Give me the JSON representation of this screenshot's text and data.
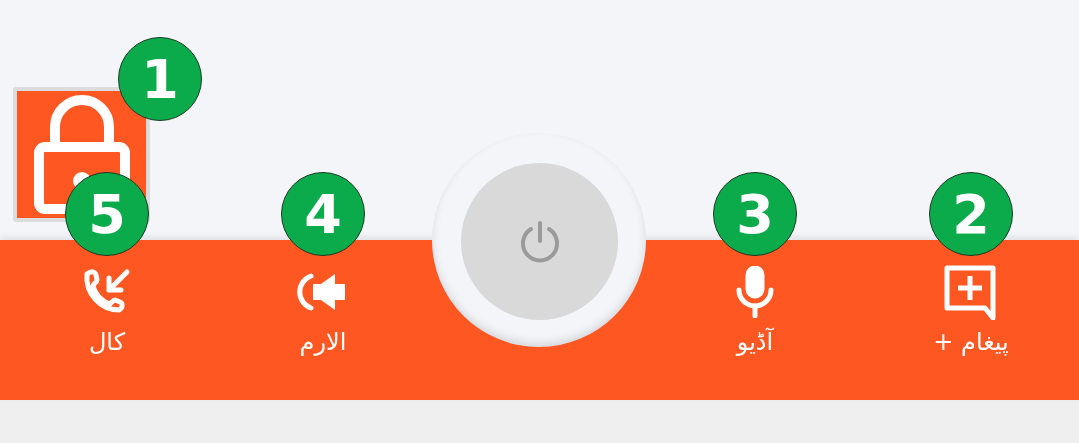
{
  "lock_tile": {
    "badge": "1"
  },
  "nav_items": [
    {
      "kind": "message",
      "label": "پیغام +",
      "badge": "2"
    },
    {
      "kind": "audio",
      "label": "آڈیو",
      "badge": "3"
    },
    {
      "kind": "alarm",
      "label": "الارم",
      "badge": "4"
    },
    {
      "kind": "call",
      "label": "کال",
      "badge": "5"
    }
  ]
}
